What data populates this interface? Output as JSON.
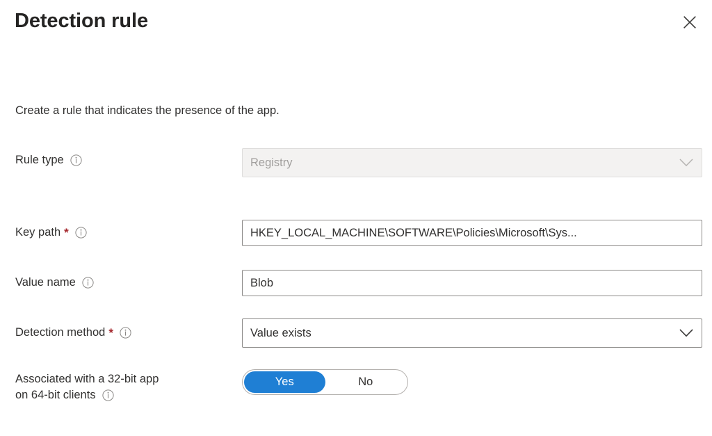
{
  "blade": {
    "title": "Detection rule",
    "close_icon": "close-icon",
    "description": "Create a rule that indicates the presence of the app."
  },
  "colors": {
    "accent_blue": "#1f7fd4",
    "required_red": "#a4262c",
    "text": "#323130",
    "disabled_text": "#a19f9d",
    "disabled_bg": "#f3f2f1",
    "border": "#8a8886"
  },
  "form": {
    "rows": [
      {
        "id": "rule-type",
        "label": "Rule type",
        "required": false,
        "info_icon": "info-icon",
        "control": "dropdown",
        "value": "Registry",
        "disabled": true,
        "chevron_icon": "chevron-down-icon"
      },
      {
        "id": "key-path",
        "label": "Key path",
        "required": true,
        "info_icon": "info-icon",
        "control": "textbox",
        "value": "HKEY_LOCAL_MACHINE\\SOFTWARE\\Policies\\Microsoft\\Sys...",
        "placeholder": "",
        "disabled": false
      },
      {
        "id": "value-name",
        "label": "Value name",
        "required": false,
        "info_icon": "info-icon",
        "control": "textbox",
        "value": "Blob",
        "placeholder": "",
        "disabled": false
      },
      {
        "id": "detection-method",
        "label": "Detection method",
        "required": true,
        "info_icon": "info-icon",
        "control": "dropdown",
        "value": "Value exists",
        "disabled": false,
        "chevron_icon": "chevron-down-icon"
      },
      {
        "id": "associated-32bit",
        "label_line1": "Associated with a 32-bit app",
        "label_line2": "on 64-bit clients",
        "required": false,
        "info_icon": "info-icon",
        "control": "toggle",
        "options": [
          "Yes",
          "No"
        ],
        "selected": "Yes"
      }
    ]
  }
}
